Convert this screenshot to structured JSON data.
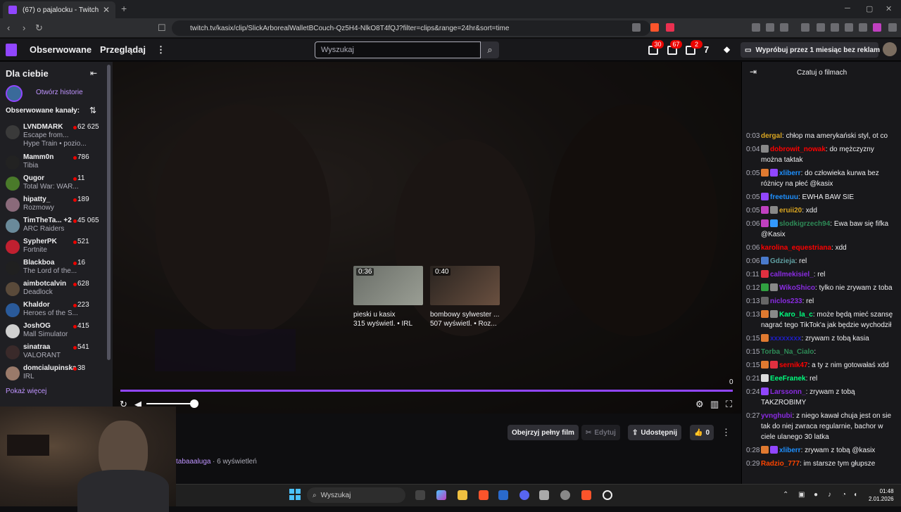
{
  "browser": {
    "tab_title": "(67) o pajalocku - Twitch",
    "url": "twitch.tv/kasix/clip/SlickArborealWalletBCouch-Qz5H4-NlkO8T4fQJ?filter=clips&range=24hr&sort=time"
  },
  "topnav": {
    "followed": "Obserwowane",
    "browse": "Przeglądaj",
    "search_placeholder": "Wyszukaj",
    "badges": [
      "30",
      "67",
      "2"
    ],
    "prime": "Wypróbuj przez 1 miesiąc bez reklam"
  },
  "sidebar": {
    "title": "Dla ciebie",
    "open_stories": "Otwórz historie",
    "followed_channels": "Obserwowane kanały:",
    "show_more": "Pokaż więcej",
    "channels": [
      {
        "name": "LVNDMARK",
        "game": "Escape from...",
        "count": "62 625",
        "extra": "Hype Train • pozio...",
        "color": "#3a3a3a"
      },
      {
        "name": "Mamm0n",
        "game": "Tibia",
        "count": "786",
        "color": "#222"
      },
      {
        "name": "Qugor",
        "game": "Total War: WAR...",
        "count": "11",
        "color": "#4a7a2a"
      },
      {
        "name": "hipatty_",
        "game": "Rozmowy",
        "count": "189",
        "color": "#8a6a7a"
      },
      {
        "name": "TimTheTa... +2",
        "game": "ARC Raiders",
        "count": "45 065",
        "color": "#6a8a9a"
      },
      {
        "name": "SypherPK",
        "game": "Fortnite",
        "count": "521",
        "color": "#c02030"
      },
      {
        "name": "Blackboa",
        "game": "The Lord of the...",
        "count": "16",
        "color": "#202020"
      },
      {
        "name": "aimbotcalvin",
        "game": "Deadlock",
        "count": "628",
        "color": "#5a4a3a"
      },
      {
        "name": "Khaldor",
        "game": "Heroes of the S...",
        "count": "223",
        "color": "#2a5a9a"
      },
      {
        "name": "JoshOG",
        "game": "Mall Simulator",
        "count": "415",
        "color": "#d0d0d0"
      },
      {
        "name": "sinatraa",
        "game": "VALORANT",
        "count": "541",
        "color": "#3a2a2a"
      },
      {
        "name": "domcialupinska",
        "game": "IRL",
        "count": "38",
        "color": "#9a7a6a"
      }
    ]
  },
  "player": {
    "timecode": "0",
    "clips": [
      {
        "duration": "0:36",
        "title": "pieski u kasix",
        "meta": "315 wyświetl. • IRL"
      },
      {
        "duration": "0:40",
        "title": "bombowy sylwester ...",
        "meta": "507 wyświetl. • Roz..."
      }
    ]
  },
  "actions": {
    "watch_full": "Obejrzyj pełny film",
    "edit": "Edytuj",
    "share": "Udostępnij",
    "likes": "0"
  },
  "clip_info": {
    "author": "tabaaaluga",
    "views": "· 6 wyświetleń"
  },
  "chat": {
    "title": "Czatuj o filmach",
    "messages": [
      {
        "t": "0:03",
        "user": "dergal",
        "color": "#daa520",
        "text": ": chłop ma amerykański styl, ot co",
        "badges": []
      },
      {
        "t": "0:04",
        "user": "dobrowit_nowak",
        "color": "#ff0000",
        "text": ": do mężczyzny można taktak",
        "badges": [
          "#888"
        ]
      },
      {
        "t": "0:05",
        "user": "xliberr",
        "color": "#1e90ff",
        "text": ": do człowieka kurwa bez różnicy na płeć @kasix",
        "badges": [
          "#e07a30",
          "#9146ff"
        ]
      },
      {
        "t": "0:05",
        "user": "freetuuu",
        "color": "#1e90ff",
        "text": ": EWHA BAW SIE",
        "badges": [
          "#9146ff"
        ]
      },
      {
        "t": "0:05",
        "user": "eruii20",
        "color": "#daa520",
        "text": ": xdd",
        "badges": [
          "#c040c0",
          "#888"
        ]
      },
      {
        "t": "0:06",
        "user": "slodkigrzech94",
        "color": "#2e8b57",
        "text": ": Ewa baw się fifka @Kasix",
        "badges": [
          "#c040c0",
          "#3399ff"
        ]
      },
      {
        "t": "0:06",
        "user": "karolina_equestriana",
        "color": "#ff0000",
        "text": ": xdd",
        "badges": []
      },
      {
        "t": "0:06",
        "user": "Gdzieja",
        "color": "#5f9ea0",
        "text": ": rel",
        "badges": [
          "#4a7acc"
        ]
      },
      {
        "t": "0:11",
        "user": "callmekisiel_",
        "color": "#8a2be2",
        "text": ": rel",
        "badges": [
          "#e03040"
        ]
      },
      {
        "t": "0:12",
        "user": "WikoShico",
        "color": "#8a2be2",
        "text": ": tylko nie zrywam z toba",
        "badges": [
          "#30a040",
          "#888"
        ]
      },
      {
        "t": "0:13",
        "user": "niclos233",
        "color": "#8a2be2",
        "text": ": rel",
        "badges": [
          "#666"
        ]
      },
      {
        "t": "0:13",
        "user": "Karo_la_c",
        "color": "#00ff7f",
        "text": ": może będą mieć szansę nagrać tego TikTok'a jak będzie wychodził",
        "badges": [
          "#e07a30",
          "#888"
        ]
      },
      {
        "t": "0:15",
        "user": "xxxxxxxx",
        "color": "#1e1ec8",
        "text": ": zrywam z tobą kasia",
        "badges": [
          "#e07a30"
        ]
      },
      {
        "t": "0:15",
        "user": "Torba_Na_Cialo",
        "color": "#2e8b57",
        "text": ":",
        "badges": []
      },
      {
        "t": "0:15",
        "user": "sernik47",
        "color": "#ff0000",
        "text": ": a ty z nim gotowałaś xdd",
        "badges": [
          "#e07a30",
          "#e03040"
        ]
      },
      {
        "t": "0:21",
        "user": "EeeFranek",
        "color": "#00ff7f",
        "text": ": rel",
        "badges": [
          "#ddd"
        ]
      },
      {
        "t": "0:24",
        "user": "Larssonn_",
        "color": "#8a2be2",
        "text": ": zrywam z tobą TAKZROBIMY",
        "badges": [
          "#9146ff"
        ]
      },
      {
        "t": "0:27",
        "user": "yvnghubi",
        "color": "#8a2be2",
        "text": ": z niego kawał chuja jest on sie tak do niej zwraca regularnie, bachor w ciele ulanego 30 latka",
        "badges": []
      },
      {
        "t": "0:28",
        "user": "xliberr",
        "color": "#1e90ff",
        "text": ": zrywam z tobą @kasix",
        "badges": [
          "#e07a30",
          "#9146ff"
        ]
      },
      {
        "t": "0:29",
        "user": "Radzio_777",
        "color": "#ff4500",
        "text": ": im starsze tym głupsze",
        "badges": []
      }
    ]
  },
  "taskbar": {
    "search": "Wyszukaj",
    "time": "01:48",
    "date": "2.01.2026"
  }
}
